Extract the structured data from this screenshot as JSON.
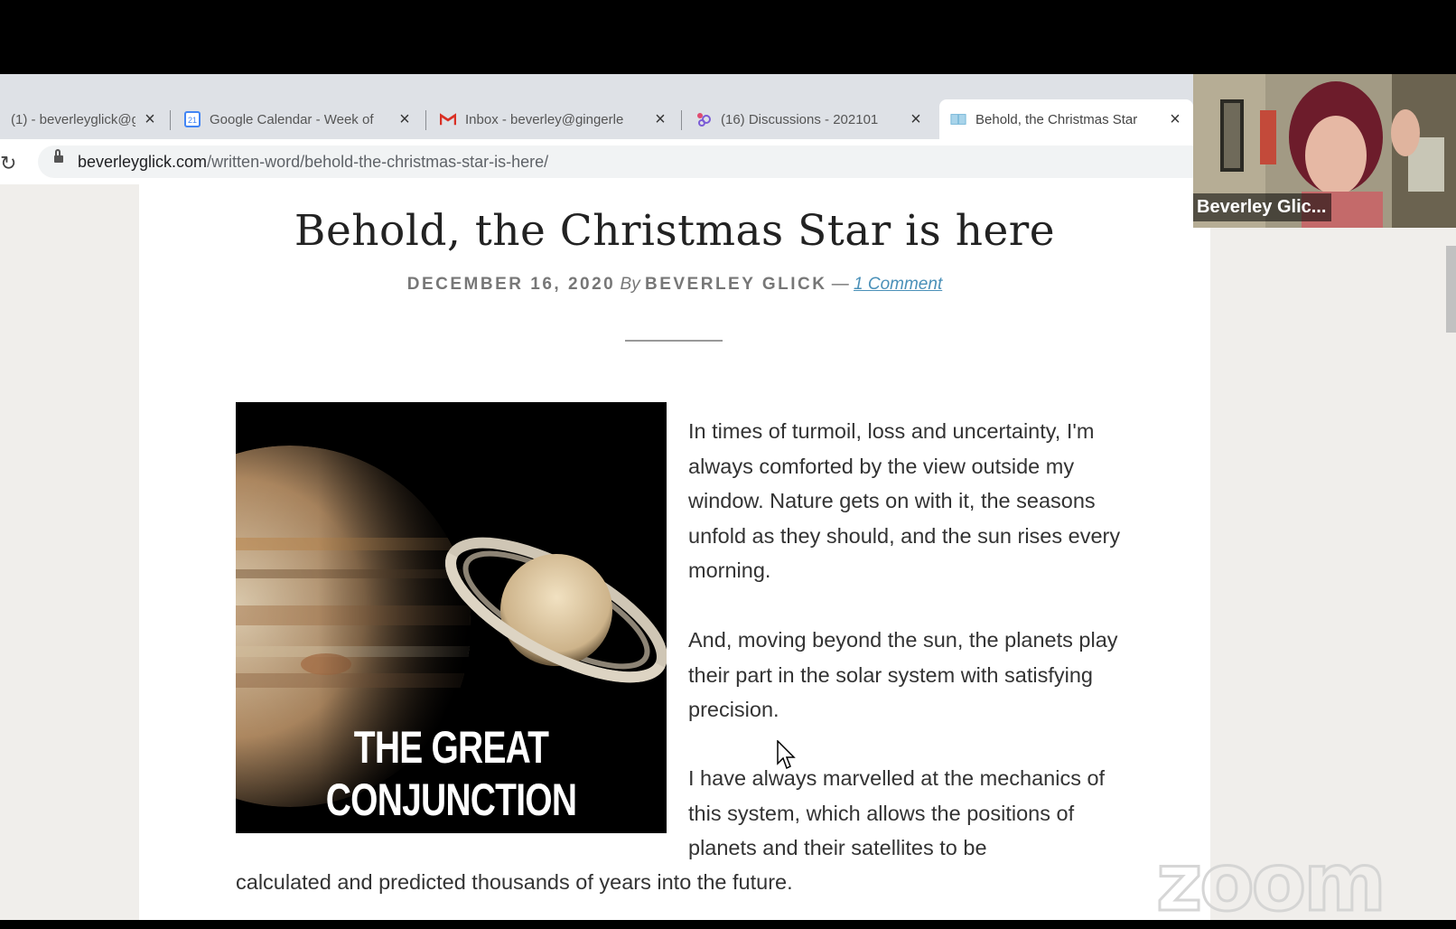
{
  "browser": {
    "tabs": [
      {
        "title": "(1) - beverleyglick@g",
        "icon": "gmail-icon",
        "active": false
      },
      {
        "title": "Google Calendar - Week of",
        "icon": "calendar-icon",
        "active": false
      },
      {
        "title": "Inbox - beverley@gingerle",
        "icon": "gmail-icon",
        "active": false
      },
      {
        "title": "(16) Discussions - 202101",
        "icon": "discussions-icon",
        "active": false
      },
      {
        "title": "Behold, the Christmas Star",
        "icon": "book-icon",
        "active": true
      }
    ],
    "url_domain": "beverleyglick.com",
    "url_path": "/written-word/behold-the-christmas-star-is-here/"
  },
  "article": {
    "title": "Behold, the Christmas Star is here",
    "date": "DECEMBER 16, 2020",
    "by": "By",
    "author": "BEVERLEY GLICK",
    "dash": "—",
    "comments": "1 Comment",
    "image_caption": "THE GREAT CONJUNCTION",
    "paragraph1": "In times of turmoil, loss and uncertainty, I'm always comforted by the view outside my window. Nature gets on with it, the seasons unfold as they should, and the sun rises every morning.",
    "paragraph2": "And, moving beyond the sun, the planets play their part in the solar system with satisfying precision.",
    "paragraph3": "I have always marvelled at the mechanics of this system, which allows the positions of planets and their satellites to be",
    "paragraph3_cont": "calculated and predicted thousands of years into the future."
  },
  "video": {
    "participant_name": "Beverley Glic..."
  },
  "watermark": "zoom",
  "colors": {
    "tab_bar": "#dee1e6",
    "page_background": "#f0eeeb",
    "link": "#4a90b8"
  }
}
